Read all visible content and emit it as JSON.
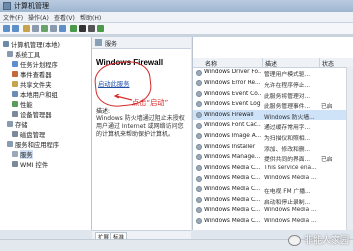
{
  "window": {
    "title": "计算机管理"
  },
  "menu": [
    "文件(F)",
    "操作(A)",
    "查看(V)",
    "帮助(H)"
  ],
  "tree": {
    "root": "计算机管理(本地)",
    "items": [
      {
        "label": "系统工具",
        "level": 1
      },
      {
        "label": "任务计划程序",
        "level": 2
      },
      {
        "label": "事件查看器",
        "level": 2
      },
      {
        "label": "共享文件夹",
        "level": 2
      },
      {
        "label": "本地用户和组",
        "level": 2
      },
      {
        "label": "性能",
        "level": 2
      },
      {
        "label": "设备管理器",
        "level": 2
      },
      {
        "label": "存储",
        "level": 1
      },
      {
        "label": "磁盘管理",
        "level": 2
      },
      {
        "label": "服务和应用程序",
        "level": 1
      },
      {
        "label": "服务",
        "level": 2
      },
      {
        "label": "WMI 控件",
        "level": 2
      }
    ]
  },
  "center": {
    "header": "服务",
    "selected_service": "Windows Firewall",
    "start_link": "启动此服务",
    "desc_title": "描述:",
    "desc_text": "Windows 防火墙通过阻止未授权用户通过 Internet 或网络访问您的计算机来帮助保护计算机。",
    "annotation": "点击“启动”",
    "tabs": [
      "扩展",
      "标准"
    ]
  },
  "list": {
    "columns": [
      "名称",
      "描述",
      "状态"
    ],
    "rows": [
      {
        "name": "Windows Driver Fo...",
        "desc": "管理用户模式驱...",
        "status": ""
      },
      {
        "name": "Windows Error Re...",
        "desc": "允许在程序停止...",
        "status": ""
      },
      {
        "name": "Windows Event Co...",
        "desc": "此服务将管理对...",
        "status": ""
      },
      {
        "name": "Windows Event Log",
        "desc": "此服务管理事件...",
        "status": "已启"
      },
      {
        "name": "Windows Firewall",
        "desc": "Windows 防火墙...",
        "status": "",
        "selected": true
      },
      {
        "name": "Windows Font Cac...",
        "desc": "通过缓存常用字...",
        "status": ""
      },
      {
        "name": "Windows Image A...",
        "desc": "为扫描仪和照相...",
        "status": ""
      },
      {
        "name": "Windows Installer",
        "desc": "添加、修改和删...",
        "status": ""
      },
      {
        "name": "Windows Manage...",
        "desc": "提供共同的界面...",
        "status": "已启"
      },
      {
        "name": "Windows Media C...",
        "desc": "This service ena...",
        "status": ""
      },
      {
        "name": "Windows Media C...",
        "desc": "Windows Media ...",
        "status": ""
      },
      {
        "name": "Windows Media C...",
        "desc": "在电视 FM 广播...",
        "status": ""
      },
      {
        "name": "Windows Media C...",
        "desc": "启动和停止录制...",
        "status": ""
      },
      {
        "name": "Windows Media C...",
        "desc": "Windows Media ...",
        "status": ""
      },
      {
        "name": "Windows Media C...",
        "desc": "Windows Media ...",
        "status": ""
      }
    ]
  },
  "watermark": "非能人家园",
  "colors": {
    "annotation": "#d52a2a",
    "link": "#1f4fa8",
    "selected_row": "#cfe3f8"
  }
}
